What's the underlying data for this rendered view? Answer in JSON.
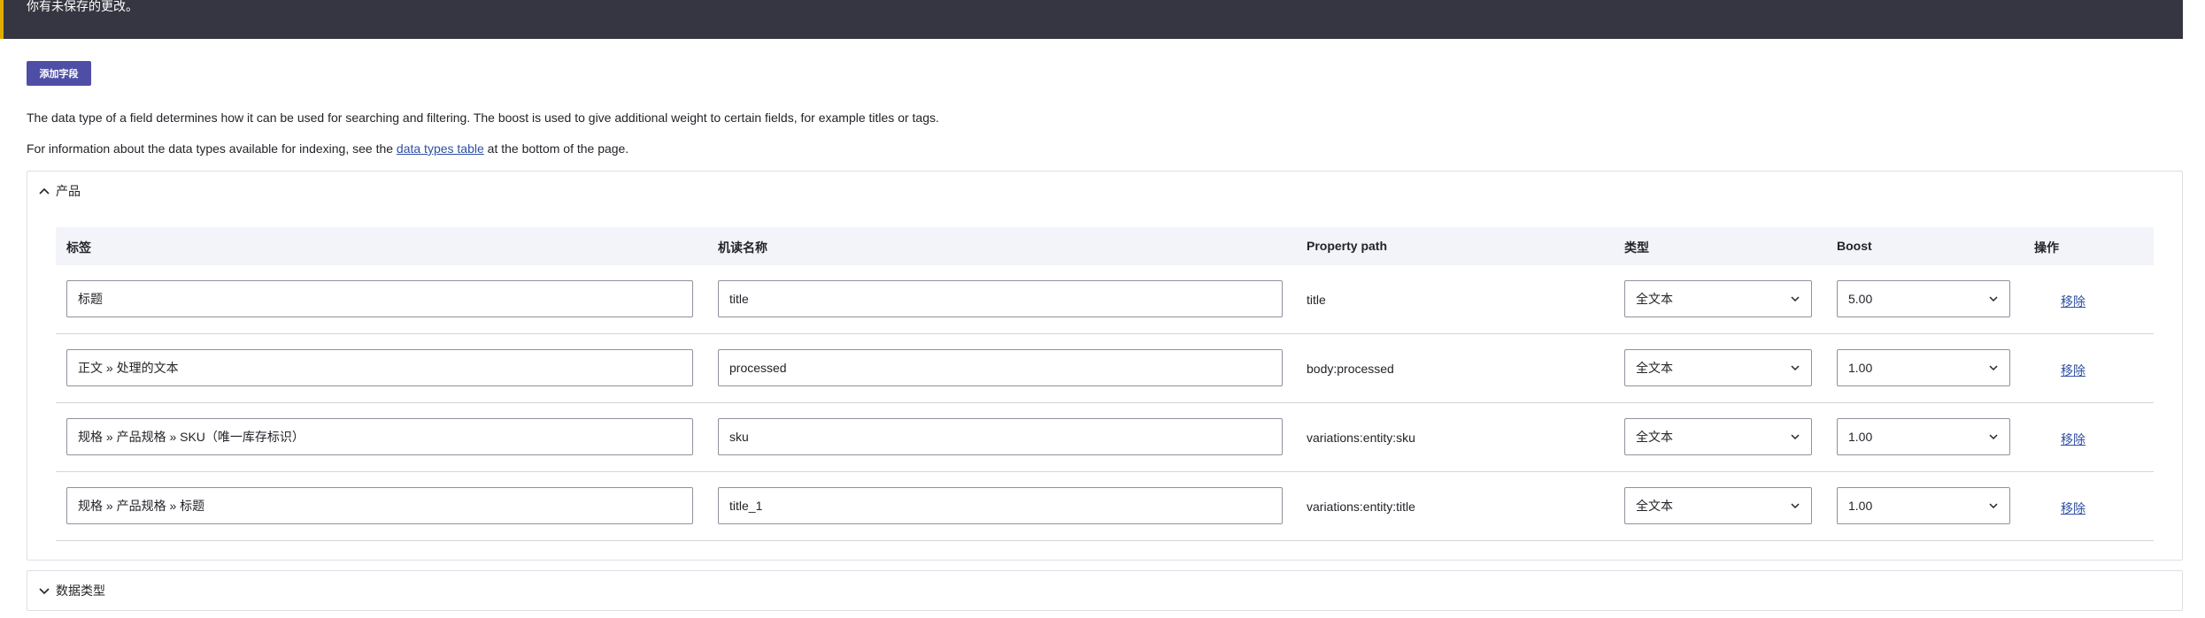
{
  "message": "你有未保存的更改。",
  "add_field_button": "添加字段",
  "description": {
    "line1": "The data type of a field determines how it can be used for searching and filtering. The boost is used to give additional weight to certain fields, for example titles or tags.",
    "line2_prefix": "For information about the data types available for indexing, see the ",
    "line2_link": "data types table",
    "line2_suffix": " at the bottom of the page."
  },
  "panel_product": {
    "title": "产品",
    "headers": {
      "label": "标签",
      "machine_name": "机读名称",
      "property_path": "Property path",
      "type": "类型",
      "boost": "Boost",
      "operations": "操作"
    },
    "rows": [
      {
        "label": "标题",
        "machine_name": "title",
        "property_path": "title",
        "type": "全文本",
        "boost": "5.00",
        "remove": "移除"
      },
      {
        "label": "正文 » 处理的文本",
        "machine_name": "processed",
        "property_path": "body:processed",
        "type": "全文本",
        "boost": "1.00",
        "remove": "移除"
      },
      {
        "label": "规格 » 产品规格 » SKU（唯一库存标识）",
        "machine_name": "sku",
        "property_path": "variations:entity:sku",
        "type": "全文本",
        "boost": "1.00",
        "remove": "移除"
      },
      {
        "label": "规格 » 产品规格 » 标题",
        "machine_name": "title_1",
        "property_path": "variations:entity:title",
        "type": "全文本",
        "boost": "1.00",
        "remove": "移除"
      }
    ]
  },
  "panel_datatypes": {
    "title": "数据类型"
  },
  "colors": {
    "message_bg": "#353641",
    "message_accent": "#e0ac00",
    "button_bg": "#4f4ea6",
    "link": "#2e4fa3"
  }
}
